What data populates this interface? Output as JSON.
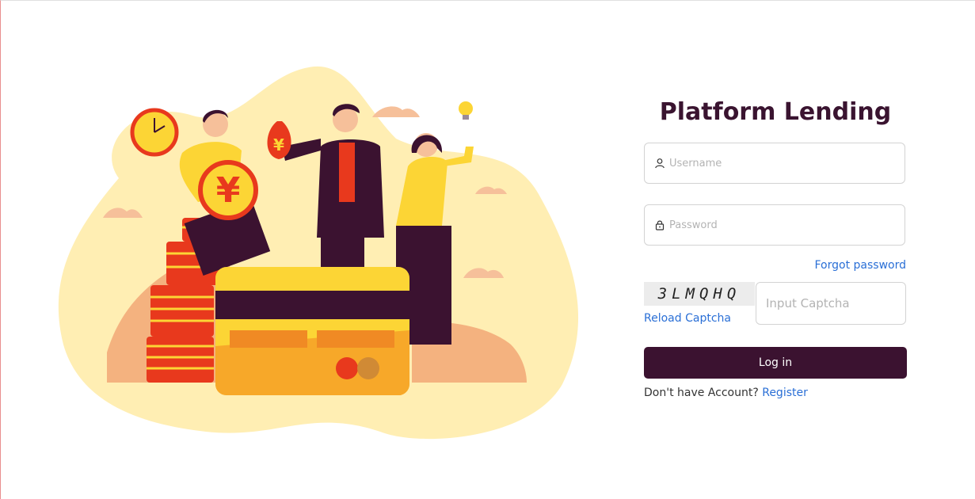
{
  "app": {
    "title": "Platform Lending"
  },
  "login": {
    "username_placeholder": "Username",
    "password_placeholder": "Password",
    "forgot_password": "Forgot password",
    "captcha_code": "3LMQHQ",
    "reload_captcha": "Reload Captcha",
    "captcha_placeholder": "Input Captcha",
    "login_button": "Log in",
    "no_account_text": "Don't have Account?",
    "register_link": "Register"
  },
  "illustration": {
    "currency_symbol": "¥"
  },
  "colors": {
    "brand": "#3b1230",
    "link": "#2a6fd6",
    "blob": "#ffeeb3",
    "accent_yellow": "#fcd535",
    "accent_red": "#e8391d"
  },
  "icons": {
    "username": "user-icon",
    "password": "lock-icon"
  }
}
